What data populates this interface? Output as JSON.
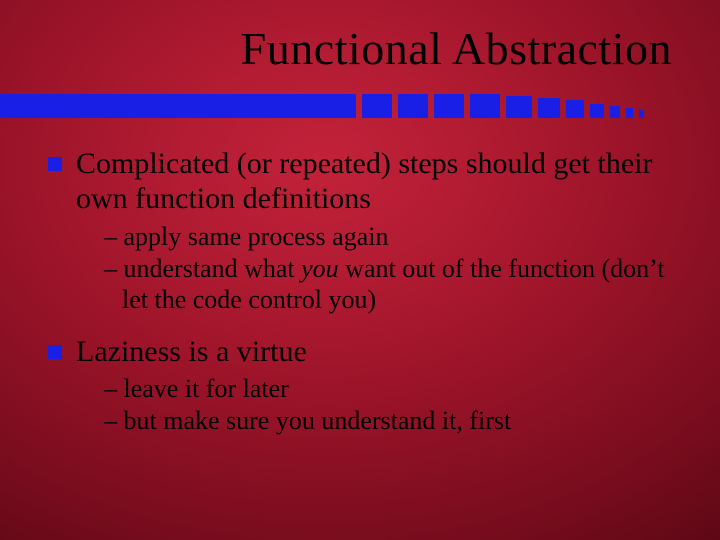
{
  "title": "Functional Abstraction",
  "points": [
    {
      "text": "Complicated (or repeated) steps should get their own function definitions",
      "subs": [
        {
          "pre": "– apply same process again"
        },
        {
          "pre": "– understand what ",
          "ital": "you",
          "post": " want out of the function (don’t let the code control you)"
        }
      ]
    },
    {
      "text": "Laziness is a virtue",
      "subs": [
        {
          "pre": "– leave it for later"
        },
        {
          "pre": "– but make sure you understand it, first"
        }
      ]
    }
  ]
}
